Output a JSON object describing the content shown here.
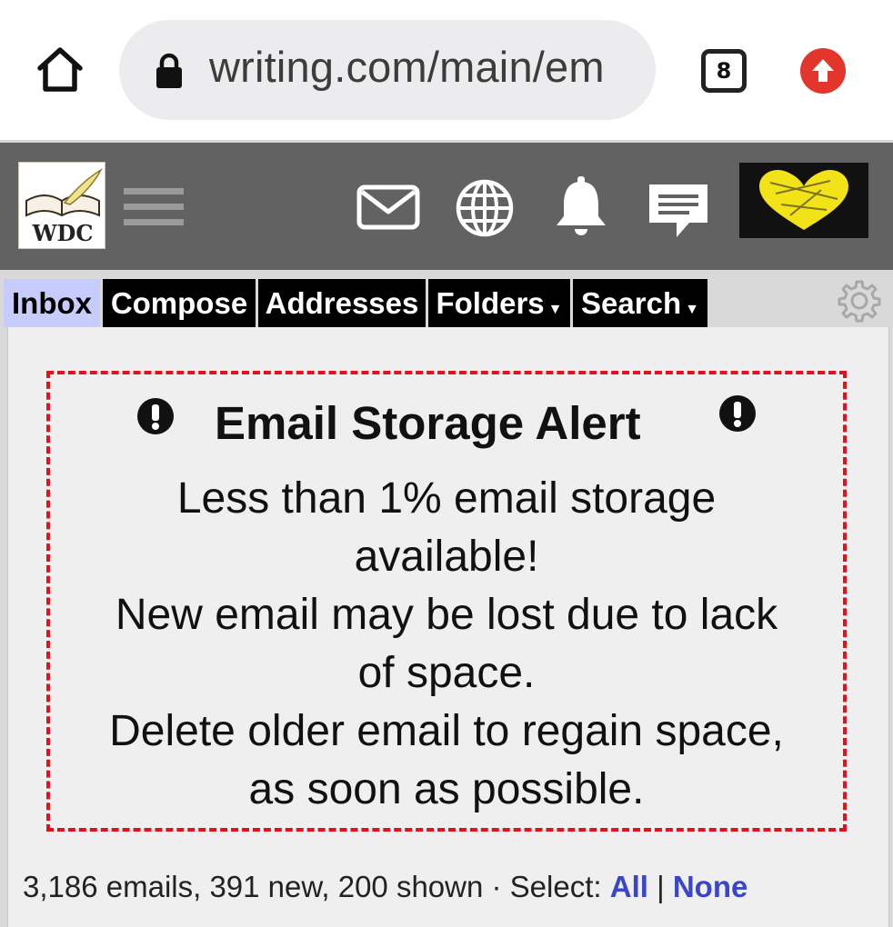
{
  "browser": {
    "url": "writing.com/main/em",
    "tab_count": "8",
    "icons": [
      "home-icon",
      "lock-icon",
      "tabs-counter",
      "update-icon"
    ]
  },
  "header": {
    "logo_text": "WDC",
    "icons": [
      "menu-icon",
      "mail-icon",
      "globe-icon",
      "bell-icon",
      "chat-icon",
      "heart-icon"
    ],
    "heart_color": "#f2e318"
  },
  "tabs": [
    {
      "label": "Inbox",
      "active": true
    },
    {
      "label": "Compose"
    },
    {
      "label": "Addresses"
    },
    {
      "label": "Folders",
      "dropdown": true
    },
    {
      "label": "Search",
      "dropdown": true
    }
  ],
  "alert": {
    "title": "Email Storage Alert",
    "lines": [
      "Less than 1% email storage",
      "available!",
      "New email may be lost due to lack",
      "of space.",
      "Delete older email to regain space,",
      "as soon as possible."
    ],
    "border_color": "#e0121c"
  },
  "summary": {
    "text": "3,186 emails, 391 new, 200 shown · Select: ",
    "all_label": "All",
    "separator": " | ",
    "none_label": "None",
    "link_color": "#3a46c7"
  }
}
